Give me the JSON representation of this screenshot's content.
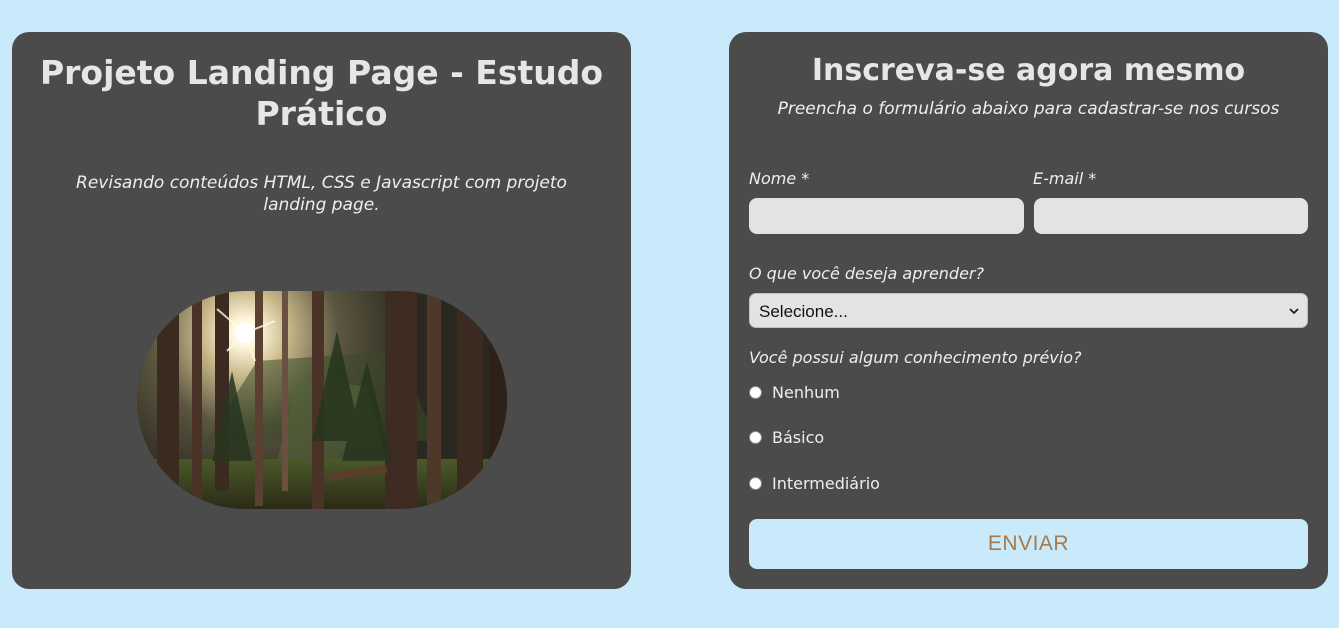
{
  "intro": {
    "title": "Projeto Landing Page - Estudo Prático",
    "subtitle": "Revisando conteúdos HTML, CSS e Javascript com projeto landing page."
  },
  "hero_image": {
    "subject": "forest-sunlight-photo"
  },
  "form": {
    "title": "Inscreva-se agora mesmo",
    "subtitle": "Preencha o formulário abaixo para cadastrar-se nos cursos",
    "name_label": "Nome *",
    "name_value": "",
    "email_label": "E-mail *",
    "email_value": "",
    "course_label": "O que você deseja aprender?",
    "course_selected": "Selecione...",
    "knowledge_label": "Você possui algum conhecimento prévio?",
    "knowledge_options": [
      {
        "label": "Nenhum",
        "checked": false
      },
      {
        "label": "Básico",
        "checked": false
      },
      {
        "label": "Intermediário",
        "checked": false
      }
    ],
    "submit_label": "ENVIAR"
  },
  "colors": {
    "background": "#c8eafb",
    "panel": "#4b4b4b",
    "input": "#e3e3e3",
    "button_text": "#a87a4a"
  }
}
